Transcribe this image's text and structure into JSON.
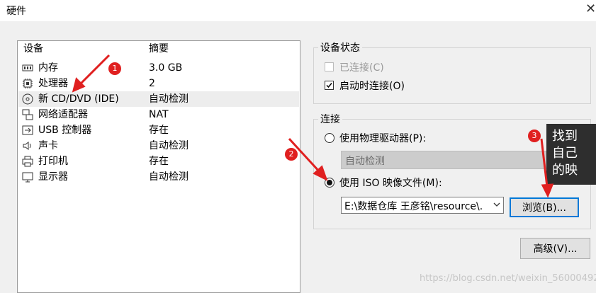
{
  "window": {
    "title": "硬件"
  },
  "device_list": {
    "headers": {
      "device": "设备",
      "summary": "摘要"
    },
    "rows": [
      {
        "name": "内存",
        "summary": "3.0 GB",
        "icon": "memory-icon"
      },
      {
        "name": "处理器",
        "summary": "2",
        "icon": "cpu-icon"
      },
      {
        "name": "新 CD/DVD (IDE)",
        "summary": "自动检测",
        "icon": "cd-dvd-icon"
      },
      {
        "name": "网络适配器",
        "summary": "NAT",
        "icon": "network-adapter-icon"
      },
      {
        "name": "USB 控制器",
        "summary": "存在",
        "icon": "usb-icon"
      },
      {
        "name": "声卡",
        "summary": "自动检测",
        "icon": "speaker-icon"
      },
      {
        "name": "打印机",
        "summary": "存在",
        "icon": "printer-icon"
      },
      {
        "name": "显示器",
        "summary": "自动检测",
        "icon": "monitor-icon"
      }
    ],
    "selected_index": 2
  },
  "device_status": {
    "legend": "设备状态",
    "connected_label": "已连接(C)",
    "connected_checked": false,
    "connected_enabled": false,
    "connect_at_power_on_label": "启动时连接(O)",
    "connect_at_power_on_checked": true
  },
  "connection": {
    "legend": "连接",
    "physical_drive_label": "使用物理驱动器(P):",
    "physical_drive_value": "自动检测",
    "iso_label": "使用 ISO 映像文件(M):",
    "iso_path": "E:\\数据仓库 王彦铭\\resource\\.",
    "selected": "iso",
    "browse_label": "浏览(B)..."
  },
  "advanced_label": "高级(V)...",
  "annotations": {
    "callout_text": "找到\n自己\n的映",
    "badges": [
      "1",
      "2",
      "3"
    ],
    "color": "#e02020"
  },
  "watermark": "https://blog.csdn.net/weixin_56000492"
}
